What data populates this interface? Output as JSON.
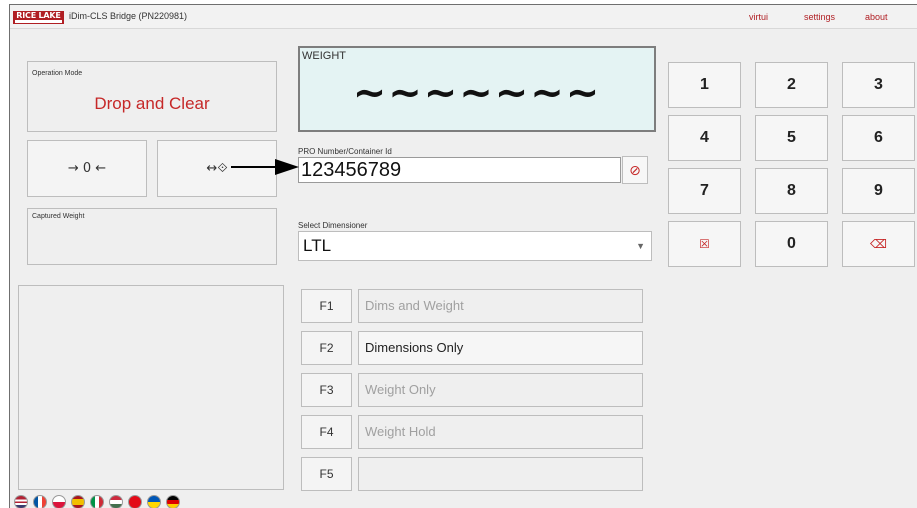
{
  "header": {
    "logo_text": "RICE LAKE",
    "title": "iDim-CLS Bridge (PN220981)",
    "menu": [
      "virtui",
      "settings",
      "about"
    ]
  },
  "operation_mode": {
    "label": "Operation Mode",
    "value": "Drop and Clear"
  },
  "zero_button": {
    "icon": "zero-icon",
    "symbol": "→ 0 ←"
  },
  "target_button": {
    "icon": "target-arrow-icon",
    "symbol": "↔⟐"
  },
  "captured_weight": {
    "label": "Captured Weight",
    "value": ""
  },
  "weight": {
    "label": "WEIGHT",
    "value": "~~~~~~~"
  },
  "pro_number": {
    "label": "PRO Number/Container Id",
    "value": "123456789",
    "clear_icon": "eraser-icon"
  },
  "dimensioner": {
    "label": "Select Dimensioner",
    "value": "LTL"
  },
  "function_keys": [
    {
      "key": "F1",
      "label": "Dims and Weight",
      "state": "disabled"
    },
    {
      "key": "F2",
      "label": "Dimensions Only",
      "state": "enabled"
    },
    {
      "key": "F3",
      "label": "Weight Only",
      "state": "disabled"
    },
    {
      "key": "F4",
      "label": "Weight Hold",
      "state": "disabled"
    },
    {
      "key": "F5",
      "label": "",
      "state": "disabled"
    }
  ],
  "keypad": {
    "keys": [
      "1",
      "2",
      "3",
      "4",
      "5",
      "6",
      "7",
      "8",
      "9",
      "☒",
      "0",
      "⌫"
    ],
    "clear_icon": "clear-x-icon",
    "backspace_icon": "backspace-icon"
  },
  "languages": [
    "en-US",
    "fr",
    "pl",
    "es",
    "it",
    "hu",
    "tr",
    "uk",
    "de"
  ],
  "colors": {
    "brand": "#b01e23",
    "accent_text": "#c62828",
    "weight_bg": "#e4f3f3"
  }
}
